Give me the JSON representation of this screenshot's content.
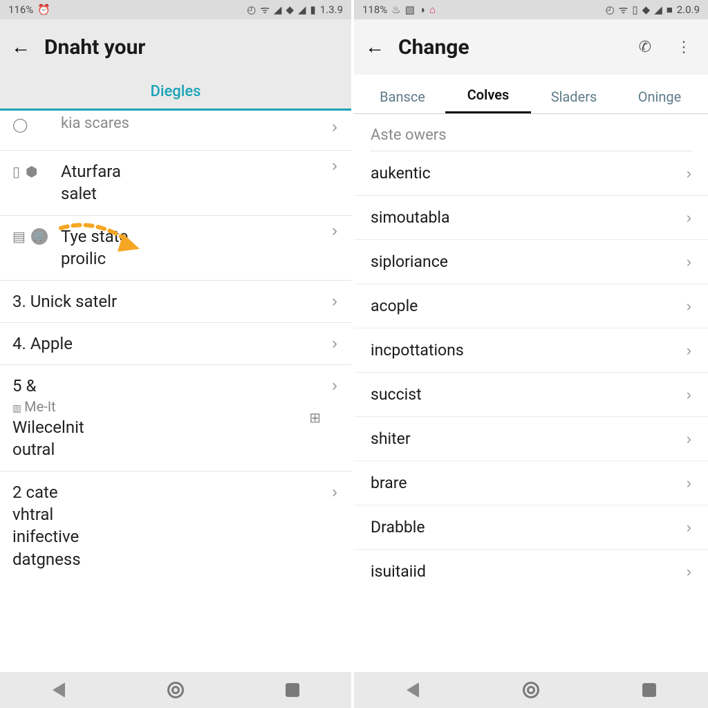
{
  "left": {
    "status": {
      "battery": "116%",
      "version": "1.3.9"
    },
    "appbar": {
      "title": "Dnaht your"
    },
    "tab": "Diegles",
    "rows": {
      "cut": "kia scares",
      "r1": {
        "line1": "Aturfara",
        "line2": "salet"
      },
      "r2": {
        "line1": "Tye state",
        "line2": "proilic"
      },
      "r3": "3. Unick satelr",
      "r4": "4. Apple",
      "r5": {
        "head": "5 &",
        "sub1": "Me-It",
        "line1": "Wilecelnit",
        "line2": "outral"
      },
      "r6": {
        "head": "2 cate",
        "line1": "vhtral",
        "line2": "inifective",
        "line3": "datgness"
      }
    }
  },
  "right": {
    "status": {
      "battery": "118%",
      "version": "2.0.9"
    },
    "appbar": {
      "title": "Change"
    },
    "tabs": [
      "Bansce",
      "Colves",
      "Sladers",
      "Oninge"
    ],
    "active_tab_index": 1,
    "section_header": "Aste owers",
    "items": [
      "aukentic",
      "simoutabla",
      "siploriance",
      "acople",
      "incpottations",
      "succist",
      "shiter",
      "brare",
      "Drabble",
      "isuitaiid"
    ]
  }
}
